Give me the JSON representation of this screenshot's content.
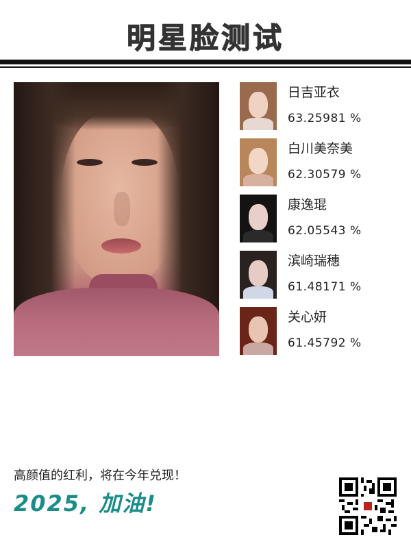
{
  "header": {
    "title": "明星脸测试"
  },
  "main_photo": {
    "icon": "portrait-photo"
  },
  "matches": [
    {
      "name": "日吉亚衣",
      "score": "63.25981 %",
      "icon": "star-portrait",
      "hair": "#9a6a4e",
      "skin": "#f0d2c2",
      "body": "#e8d8d2"
    },
    {
      "name": "白川美奈美",
      "score": "62.30579 %",
      "icon": "star-portrait",
      "hair": "#b8865a",
      "skin": "#f2d6c6",
      "body": "#d8b0a0"
    },
    {
      "name": "康逸琨",
      "score": "62.05543 %",
      "icon": "star-portrait",
      "hair": "#141212",
      "skin": "#e8d0c8",
      "body": "#2a2a2a"
    },
    {
      "name": "滨崎瑞穗",
      "score": "61.48171 %",
      "icon": "star-portrait",
      "hair": "#2a2220",
      "skin": "#e6ccc4",
      "body": "#d0d8e8"
    },
    {
      "name": "关心妍",
      "score": "61.45792 %",
      "icon": "star-portrait",
      "hair": "#6a2418",
      "skin": "#e8c4b2",
      "body": "#c8a8a0"
    }
  ],
  "footer": {
    "tagline": "高颜值的红利，将在今年兑现！",
    "slogan": "2025, 加油!",
    "qr_icon": "qr-code-icon"
  },
  "colors": {
    "accent": "#1c8c88",
    "rule": "#111111",
    "title": "#333333"
  }
}
